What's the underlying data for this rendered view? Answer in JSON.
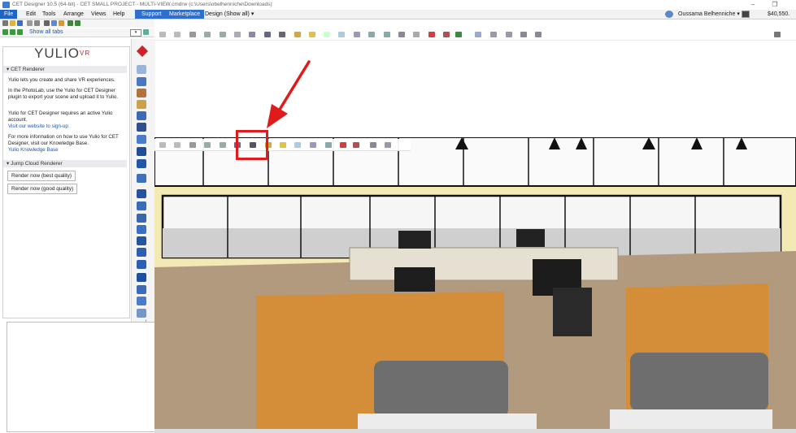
{
  "window": {
    "title": "CET Designer 10.5 (64-bit) - CET SMALL PROJECT - MULTI-VIEW.cmdrw (c:\\Users\\obelhenniche\\Downloads)",
    "minimize_glyph": "–",
    "restore_glyph": "❐",
    "close_glyph": "✕"
  },
  "menu": {
    "file": "File",
    "edit": "Edit",
    "tools": "Tools",
    "arrange": "Arrange",
    "views": "Views",
    "help": "Help",
    "support": "Support",
    "marketplace": "Marketplace",
    "view_mode": "Design (Show all)",
    "user_name": "Oussama Belhenniche",
    "price": "$40,550."
  },
  "left_toolbar": {
    "show_all_tabs": "Show all tabs",
    "combo_arrow": "▾"
  },
  "yulio_panel": {
    "logo_text": "YULIO",
    "logo_sup": "VR",
    "section_cet": "CET Renderer",
    "intro": "Yulio lets you create and share VR experiences.",
    "photolab": "In the PhotoLab, use the Yulio for CET Designer plugin to export your scene and upload it to Yulio.",
    "account": "Yulio for CET Designer requires an active Yulio account.",
    "signup_link": "Visit our website to sign-up.",
    "more_info": "For more information on how to use Yulio for CET Designer, visit our Knowledge Base.",
    "kb_link": "Yulio Knowledge Base",
    "section_jump": "Jump Cloud Renderer",
    "render_best": "Render now (best quality)",
    "render_good": "Render now (good quality)"
  },
  "colors": {
    "accent_blue": "#1f64c3",
    "annotation_red": "#e01b1b",
    "wall_yellow": "#f3e9b4",
    "floor_wood": "#b29a7f",
    "desk_orange": "#d48e3a",
    "sofa_gray": "#6e6e6e"
  },
  "annotation": {
    "arrow_target": "photo-lab-button",
    "highlight_color": "#e01b1b"
  }
}
